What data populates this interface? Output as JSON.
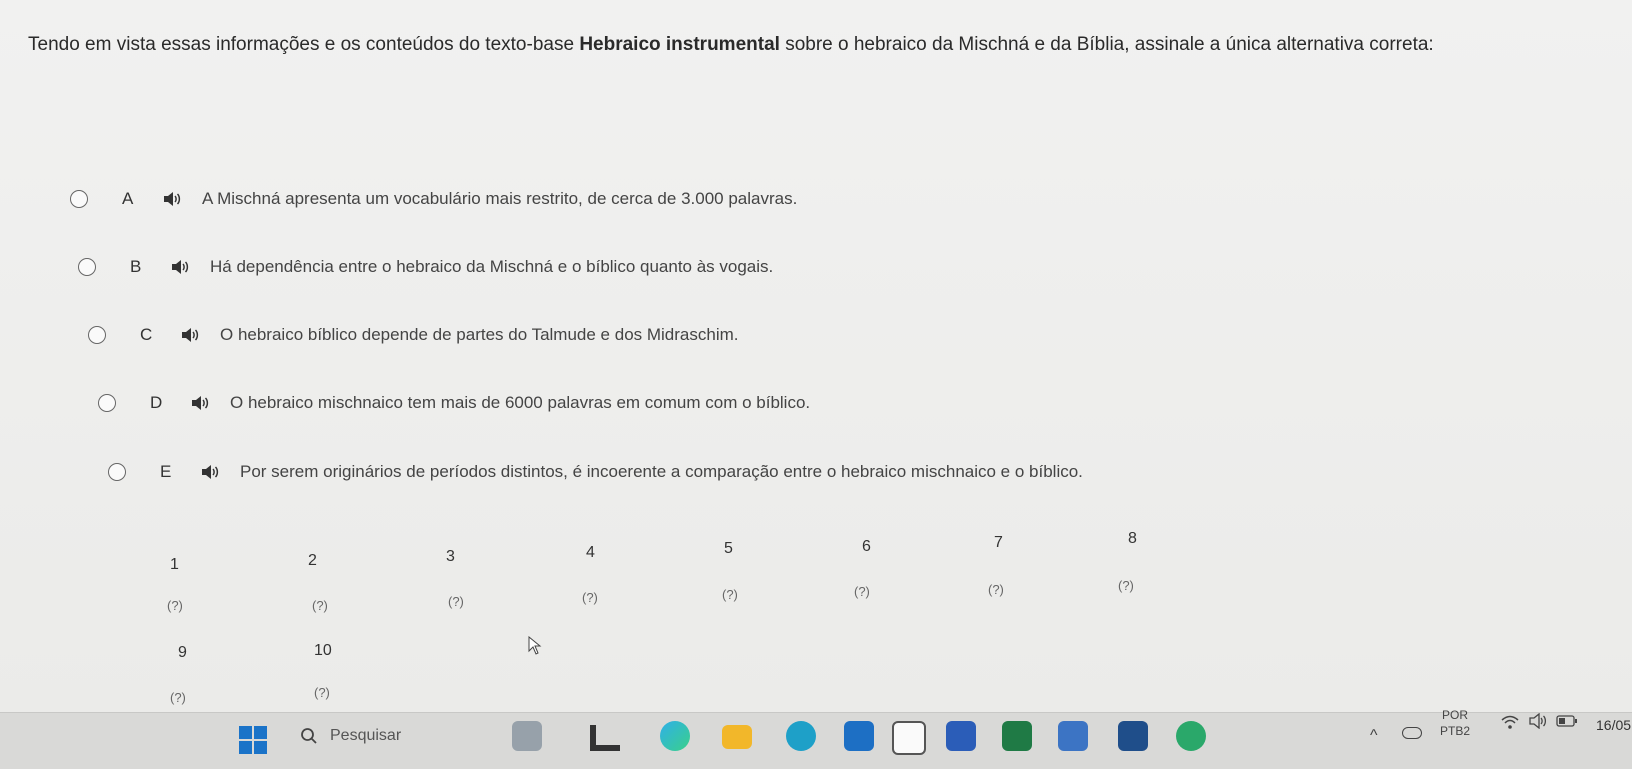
{
  "question": {
    "prefix": "Tendo em vista essas informações e os conteúdos do texto-base ",
    "bold": "Hebraico instrumental",
    "suffix": " sobre o hebraico da Mischná e da Bíblia, assinale a única alternativa correta:"
  },
  "options": [
    {
      "letter": "A",
      "text": "A Mischná apresenta um vocabulário mais restrito, de cerca de 3.000 palavras."
    },
    {
      "letter": "B",
      "text": "Há dependência entre o hebraico da Mischná e o bíblico quanto às vogais."
    },
    {
      "letter": "C",
      "text": "O hebraico bíblico depende de partes do Talmude e dos Midraschim."
    },
    {
      "letter": "D",
      "text": "O hebraico mischnaico tem mais de 6000 palavras em comum com o bíblico."
    },
    {
      "letter": "E",
      "text": "Por serem originários de períodos distintos, é incoerente a comparação entre o hebraico mischnaico e o bíblico."
    }
  ],
  "question_nav": [
    {
      "num": "1",
      "status": "(?)"
    },
    {
      "num": "2",
      "status": "(?)"
    },
    {
      "num": "3",
      "status": "(?)"
    },
    {
      "num": "4",
      "status": "(?)"
    },
    {
      "num": "5",
      "status": "(?)"
    },
    {
      "num": "6",
      "status": "(?)"
    },
    {
      "num": "7",
      "status": "(?)"
    },
    {
      "num": "8",
      "status": "(?)"
    },
    {
      "num": "9",
      "status": "(?)"
    },
    {
      "num": "10",
      "status": "(?)"
    }
  ],
  "taskbar": {
    "search_label": "Pesquisar",
    "lang_line1": "POR",
    "lang_line2": "PTB2",
    "time": "16/05"
  },
  "icons": {
    "start": "windows-start-icon",
    "search": "search-icon",
    "speaker": "speaker-icon",
    "wifi": "wifi-icon",
    "volume": "volume-icon",
    "battery": "battery-icon"
  }
}
